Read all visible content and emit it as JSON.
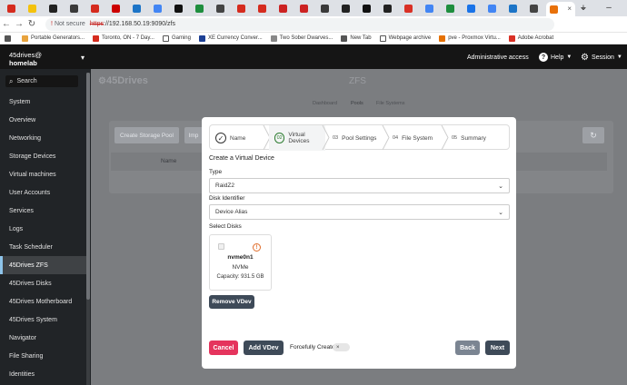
{
  "browser": {
    "tabs": [
      {
        "icon": "canada-flag-icon",
        "color": "#d52b1e"
      },
      {
        "icon": "smiley-icon",
        "color": "#f4c20d"
      },
      {
        "icon": "amazon-icon",
        "color": "#222222"
      },
      {
        "icon": "globe-icon",
        "color": "#3a3a3a"
      },
      {
        "icon": "canada-flag-icon",
        "color": "#d52b1e"
      },
      {
        "icon": "target-icon",
        "color": "#cc0000"
      },
      {
        "icon": "w-logo-icon",
        "color": "#1c74c7"
      },
      {
        "icon": "google-icon",
        "color": "#4285f4"
      },
      {
        "icon": "github-icon",
        "color": "#111111"
      },
      {
        "icon": "green-square-icon",
        "color": "#1e8e3e"
      },
      {
        "icon": "cross-icon",
        "color": "#444444"
      },
      {
        "icon": "canada-flag-icon",
        "color": "#d52b1e"
      },
      {
        "icon": "canada-flag-icon",
        "color": "#d52b1e"
      },
      {
        "icon": "red-car-icon",
        "color": "#cc2222"
      },
      {
        "icon": "red-car-icon",
        "color": "#cc2222"
      },
      {
        "icon": "globe-icon",
        "color": "#3a3a3a"
      },
      {
        "icon": "a-icon",
        "color": "#222222"
      },
      {
        "icon": "black-square-icon",
        "color": "#111111"
      },
      {
        "icon": "a-icon",
        "color": "#222222"
      },
      {
        "icon": "pdf-icon",
        "color": "#d93025"
      },
      {
        "icon": "google-icon",
        "color": "#4285f4"
      },
      {
        "icon": "green-square-icon",
        "color": "#1e8e3e"
      },
      {
        "icon": "blue-square-icon",
        "color": "#1a73e8"
      },
      {
        "icon": "google-icon",
        "color": "#4285f4"
      },
      {
        "icon": "w-logo-icon",
        "color": "#1c74c7"
      },
      {
        "icon": "edit-icon",
        "color": "#444444"
      }
    ],
    "active_tab": {
      "icon": "45drives-icon",
      "color": "#e8710a",
      "close": "×"
    },
    "new_tab": "+",
    "window_controls": {
      "chevron": "⌄",
      "minimize": "–",
      "maximize": "▢",
      "close": "✕"
    },
    "nav": {
      "back": "←",
      "forward": "→",
      "reload": "↻"
    },
    "url": {
      "warning_icon": "!",
      "not_secure": "Not secure",
      "protocol": "https",
      "rest": "://192.168.50.19:9090/zfs"
    },
    "bookmarks": [
      {
        "icon": "grid-icon",
        "label": "",
        "color": "#555555"
      },
      {
        "icon": "page-icon",
        "label": "Portable Generators...",
        "color": "#e8a33d"
      },
      {
        "icon": "canada-flag-icon",
        "label": "Toronto, ON - 7 Day...",
        "color": "#d52b1e"
      },
      {
        "icon": "folder-icon",
        "label": "Gaming",
        "color": "#555555"
      },
      {
        "icon": "xe-icon",
        "label": "XE Currency Conver...",
        "color": "#1c3f94"
      },
      {
        "icon": "page-icon",
        "label": "Two Sober Dwarves...",
        "color": "#888888"
      },
      {
        "icon": "globe-icon",
        "label": "New Tab",
        "color": "#555555"
      },
      {
        "icon": "folder-icon",
        "label": "Webpage archive",
        "color": "#555555"
      },
      {
        "icon": "proxmox-icon",
        "label": "pve - Proxmox Virtu...",
        "color": "#e57000"
      },
      {
        "icon": "pdf-icon",
        "label": "Adobe Acrobat",
        "color": "#d93025"
      }
    ]
  },
  "cockpit": {
    "host_user": "45drives@",
    "host_name": "homelab",
    "host_menu": "▾",
    "search_placeholder": "Search",
    "admin_access": "Administrative access",
    "help": "Help",
    "session": "Session",
    "sidebar": [
      "System",
      "Overview",
      "Networking",
      "Storage Devices",
      "Virtual machines",
      "User Accounts",
      "Services",
      "Logs",
      "Task Scheduler",
      "45Drives ZFS",
      "45Drives Disks",
      "45Drives Motherboard",
      "45Drives System",
      "Navigator",
      "File Sharing",
      "Identities"
    ],
    "active_item": "45Drives ZFS"
  },
  "background": {
    "brand": "45Drives",
    "title": "ZFS",
    "subtabs": [
      "Dashboard",
      "Pools",
      "File Systems"
    ],
    "buttons": [
      "Create Storage Pool",
      "Imp"
    ],
    "col_name": "Name"
  },
  "modal": {
    "steps": [
      {
        "num": "✓",
        "label": "Name"
      },
      {
        "num": "02",
        "label": "Virtual Devices"
      },
      {
        "num": "03",
        "label": "Pool Settings"
      },
      {
        "num": "04",
        "label": "File System"
      },
      {
        "num": "05",
        "label": "Summary"
      }
    ],
    "section_title": "Create a Virtual Device",
    "type_label": "Type",
    "type_value": "RaidZ2",
    "disk_id_label": "Disk Identifier",
    "disk_id_value": "Device Alias",
    "select_disks_label": "Select Disks",
    "disk": {
      "name": "nvme0n1",
      "kind": "NVMe",
      "capacity": "Capacity: 931.5 GB",
      "warn": "!"
    },
    "remove_vdev": "Remove VDev",
    "cancel": "Cancel",
    "add_vdev": "Add VDev",
    "forcefully_create": "Forcefully Create",
    "toggle_mark": "×",
    "back": "Back",
    "next": "Next"
  },
  "colors": {
    "cancel": "#e5345d",
    "dark_btn": "#3e4a58",
    "back": "#7b8592",
    "accent": "#8ec4ea"
  }
}
